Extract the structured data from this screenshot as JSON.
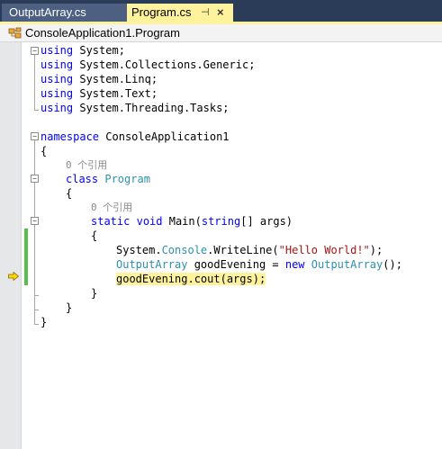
{
  "tabs": [
    {
      "label": "OutputArray.cs",
      "active": false
    },
    {
      "label": "Program.cs",
      "active": true
    }
  ],
  "tab_pin_glyph": "⊣",
  "tab_close_glyph": "×",
  "nav": {
    "label": "ConsoleApplication1.Program"
  },
  "code": {
    "using_kw": "using",
    "using_namespaces": [
      "System;",
      "System.Collections.Generic;",
      "System.Linq;",
      "System.Text;",
      "System.Threading.Tasks;"
    ],
    "namespace_kw": "namespace",
    "namespace_name": "ConsoleApplication1",
    "open_brace": "{",
    "close_brace": "}",
    "ref_count_label": "0 个引用",
    "class_kw": "class",
    "class_name": "Program",
    "static_kw": "static",
    "void_kw": "void",
    "method_name": "Main(",
    "string_kw": "string",
    "params_rest": "[] args)",
    "stmt1": {
      "a": "System.",
      "b": "Console",
      "c": ".WriteLine(",
      "d": "\"Hello World!\"",
      "e": ");"
    },
    "stmt2": {
      "type1": "OutputArray",
      "var": " goodEvening = ",
      "new_kw": "new",
      "type2": "OutputArray",
      "end": "();"
    },
    "stmt3": "goodEvening.cout(args);"
  },
  "colors": {
    "tab_active": "#fff29d",
    "tab_strip": "#2b3c59",
    "keyword": "#0000ff",
    "type": "#2b91af",
    "string": "#a31515",
    "change_bar": "#57c04b",
    "current_statement": "#fff29d"
  },
  "icons": [
    "pin-icon",
    "close-icon",
    "class-icon",
    "execution-arrow-icon",
    "fold-icon"
  ]
}
